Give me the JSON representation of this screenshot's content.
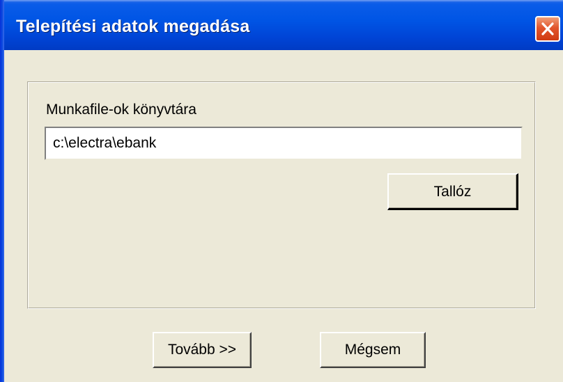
{
  "window": {
    "title": "Telepítési adatok megadása",
    "close_label": "Close"
  },
  "form": {
    "directory_label": "Munkafile-ok könyvtára",
    "directory_value": "c:\\electra\\ebank",
    "browse_label": "Tallóz"
  },
  "footer": {
    "next_label": "Tovább >>",
    "cancel_label": "Mégsem"
  },
  "colors": {
    "titlebar": "#0055e5",
    "dialog_background": "#ece9d8",
    "close_button": "#e2552c",
    "title_text": "#ffffff"
  },
  "icons": {
    "close": "close-icon"
  }
}
